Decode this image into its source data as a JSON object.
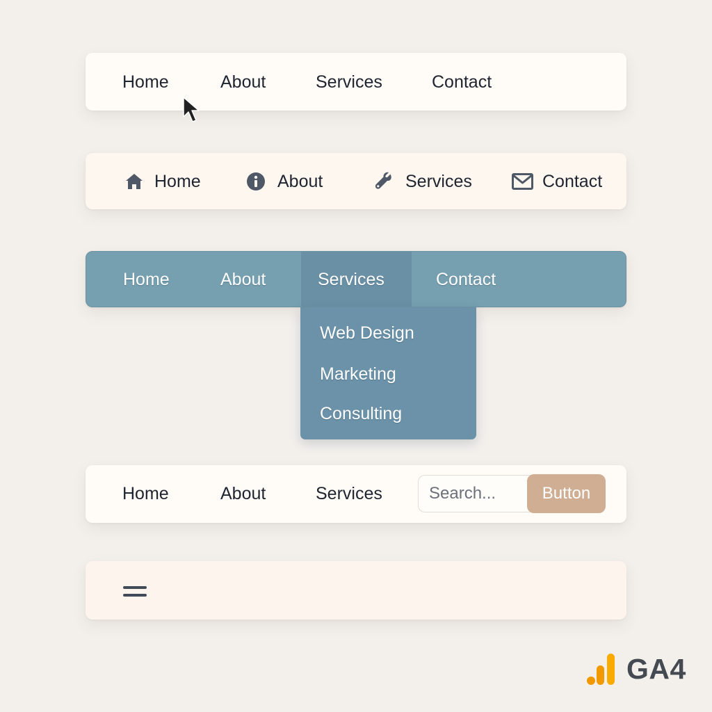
{
  "navbar_plain": {
    "items": [
      "Home",
      "About",
      "Services",
      "Contact"
    ]
  },
  "navbar_icons": {
    "items": [
      {
        "label": "Home",
        "icon": "home-icon"
      },
      {
        "label": "About",
        "icon": "info-icon"
      },
      {
        "label": "Services",
        "icon": "wrench-icon"
      },
      {
        "label": "Contact",
        "icon": "mail-icon"
      }
    ]
  },
  "navbar_dropdown": {
    "items": [
      "Home",
      "About",
      "Services",
      "Contact"
    ],
    "active": "Services",
    "dropdown_items": [
      "Web Design",
      "Marketing",
      "Consulting"
    ]
  },
  "navbar_search": {
    "items": [
      "Home",
      "About",
      "Services"
    ],
    "search_placeholder": "Search...",
    "button_label": "Button"
  },
  "navbar_mobile": {
    "icon": "hamburger-menu-icon"
  },
  "logo": {
    "text": "GA4",
    "icon": "bar-chart-icon"
  },
  "colors": {
    "background": "#f3f0ec",
    "bar_light": "#fffbf6",
    "bar_blue": "#769faf",
    "dropdown_blue": "#6b92a8",
    "button_tan": "#cfae93",
    "logo_orange": "#f29900"
  }
}
